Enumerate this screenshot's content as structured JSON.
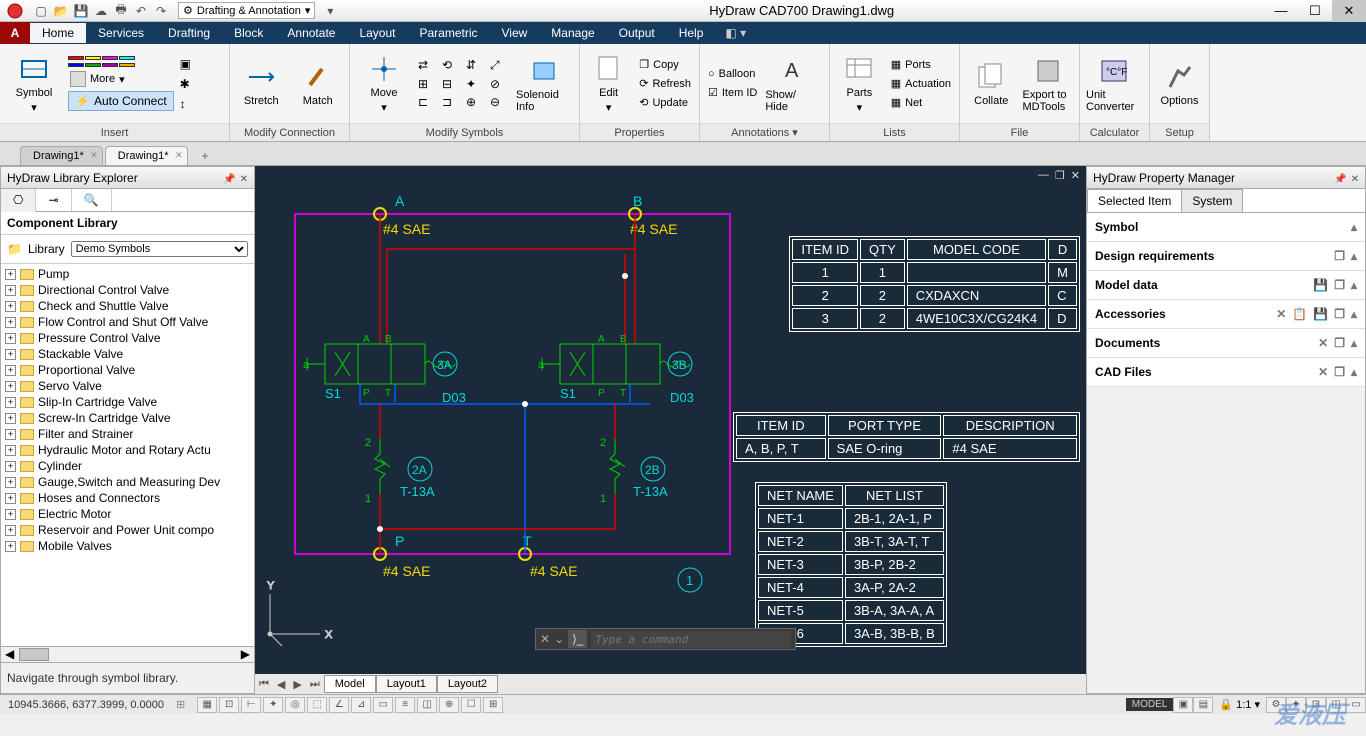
{
  "app": {
    "title": "HyDraw CAD700   Drawing1.dwg",
    "workspace": "Drafting & Annotation"
  },
  "ribbon_tabs": [
    "Home",
    "Services",
    "Drafting",
    "Block",
    "Annotate",
    "Layout",
    "Parametric",
    "View",
    "Manage",
    "Output",
    "Help"
  ],
  "ribbon": {
    "insert": {
      "title": "Insert",
      "symbol": "Symbol",
      "more": "More",
      "auto_connect": "Auto Connect"
    },
    "modify_conn": {
      "title": "Modify Connection",
      "stretch": "Stretch",
      "match": "Match"
    },
    "modify_symbols": {
      "title": "Modify Symbols",
      "move": "Move",
      "solenoid": "Solenoid Info"
    },
    "properties": {
      "title": "Properties",
      "edit": "Edit",
      "copy": "Copy",
      "refresh": "Refresh",
      "update": "Update"
    },
    "annotations": {
      "title": "Annotations ▾",
      "show_hide": "Show/ Hide",
      "balloon": "Balloon",
      "item_id": "Item ID"
    },
    "lists": {
      "title": "Lists",
      "parts": "Parts",
      "ports": "Ports",
      "actuation": "Actuation",
      "net": "Net"
    },
    "file": {
      "title": "File",
      "collate": "Collate",
      "export": "Export to MDTools"
    },
    "calculator": {
      "title": "Calculator",
      "unit": "Unit Converter"
    },
    "setup": {
      "title": "Setup",
      "options": "Options"
    }
  },
  "doc_tabs": [
    {
      "label": "Drawing1*",
      "active": false
    },
    {
      "label": "Drawing1*",
      "active": true
    }
  ],
  "library": {
    "panel_title": "HyDraw Library Explorer",
    "section": "Component Library",
    "lib_label": "Library",
    "lib_value": "Demo Symbols",
    "hint": "Navigate through symbol library.",
    "items": [
      "Pump",
      "Directional Control Valve",
      "Check and Shuttle Valve",
      "Flow Control and Shut Off Valve",
      "Pressure Control Valve",
      "Stackable Valve",
      "Proportional Valve",
      "Servo Valve",
      "Slip-In Cartridge Valve",
      "Screw-In Cartridge Valve",
      "Filter and Strainer",
      "Hydraulic Motor and Rotary Actu",
      "Cylinder",
      "Gauge,Switch and Measuring Dev",
      "Hoses and Connectors",
      "Electric Motor",
      "Reservoir and Power Unit compo",
      "Mobile Valves"
    ]
  },
  "cmd_placeholder": "Type a command",
  "layout_tabs": [
    "Model",
    "Layout1",
    "Layout2"
  ],
  "pm": {
    "title": "HyDraw Property Manager",
    "tabs": [
      "Selected Item",
      "System"
    ],
    "sections": [
      "Symbol",
      "Design requirements",
      "Model data",
      "Accessories",
      "Documents",
      "CAD Files"
    ]
  },
  "canvas": {
    "ports": {
      "A": "A",
      "B": "B",
      "P": "P",
      "T": "T",
      "sae": "#4 SAE"
    },
    "labels": {
      "s1": "S1",
      "d03": "D03",
      "t13a": "T-13A",
      "a_small": "a"
    },
    "circles": {
      "c3a": "3A",
      "c3b": "3B",
      "c2a": "2A",
      "c2b": "2B",
      "c1": "1"
    },
    "tiny": {
      "a": "A",
      "b": "B",
      "p": "P",
      "t": "T",
      "two": "2",
      "one": "1"
    }
  },
  "tables": {
    "items": {
      "headers": [
        "ITEM ID",
        "QTY",
        "MODEL CODE",
        "D"
      ],
      "rows": [
        [
          "1",
          "1",
          "",
          "M"
        ],
        [
          "2",
          "2",
          "CXDAXCN",
          "C"
        ],
        [
          "3",
          "2",
          "4WE10C3X/CG24K4",
          "D"
        ]
      ]
    },
    "ports": {
      "headers": [
        "ITEM ID",
        "PORT TYPE",
        "DESCRIPTION"
      ],
      "rows": [
        [
          "A, B, P, T",
          "SAE O-ring",
          "#4 SAE"
        ]
      ]
    },
    "nets": {
      "headers": [
        "NET NAME",
        "NET LIST"
      ],
      "rows": [
        [
          "NET-1",
          "2B-1, 2A-1, P"
        ],
        [
          "NET-2",
          "3B-T, 3A-T, T"
        ],
        [
          "NET-3",
          "3B-P, 2B-2"
        ],
        [
          "NET-4",
          "3A-P, 2A-2"
        ],
        [
          "NET-5",
          "3B-A, 3A-A, A"
        ],
        [
          "NET-6",
          "3A-B, 3B-B, B"
        ]
      ]
    }
  },
  "status": {
    "coords": "10945.3666, 6377.3999, 0.0000",
    "model": "MODEL",
    "scale": "1:1"
  },
  "watermark": "爱液压"
}
